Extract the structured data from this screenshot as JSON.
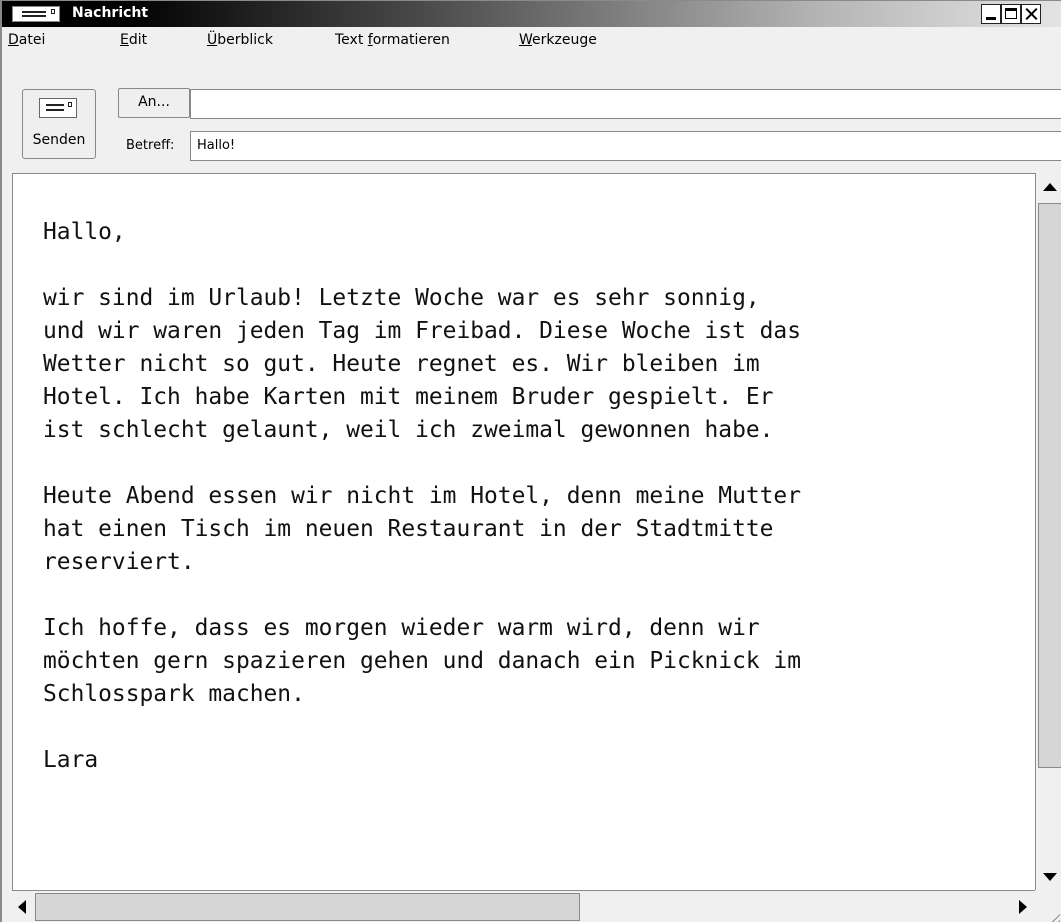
{
  "window": {
    "title": "Nachricht",
    "icon": "envelope-icon",
    "controls": [
      "minimize-icon",
      "maximize-icon",
      "close-icon"
    ]
  },
  "menu": [
    {
      "accel": "D",
      "rest": "atei"
    },
    {
      "accel": "E",
      "rest": "dit"
    },
    {
      "accel": "Ü",
      "rest": "berblick"
    },
    {
      "pre": "Text ",
      "accel": "f",
      "rest": "ormatieren"
    },
    {
      "accel": "W",
      "rest": "erkzeuge"
    }
  ],
  "toolbar": {
    "send_label": "Senden",
    "send_icon": "envelope-icon"
  },
  "compose": {
    "to_button": "An...",
    "to_value": "",
    "subject_label": "Betreff:",
    "subject_value": "Hallo!"
  },
  "message": {
    "body": "Hallo,\n\nwir sind im Urlaub! Letzte Woche war es sehr sonnig,\nund wir waren jeden Tag im Freibad. Diese Woche ist das\nWetter nicht so gut. Heute regnet es. Wir bleiben im\nHotel. Ich habe Karten mit meinem Bruder gespielt. Er\nist schlecht gelaunt, weil ich zweimal gewonnen habe.\n\nHeute Abend essen wir nicht im Hotel, denn meine Mutter\nhat einen Tisch im neuen Restaurant in der Stadtmitte\nreserviert.\n\nIch hoffe, dass es morgen wieder warm wird, denn wir\nmöchten gern spazieren gehen und danach ein Picknick im\nSchlosspark machen.\n\nLara"
  }
}
